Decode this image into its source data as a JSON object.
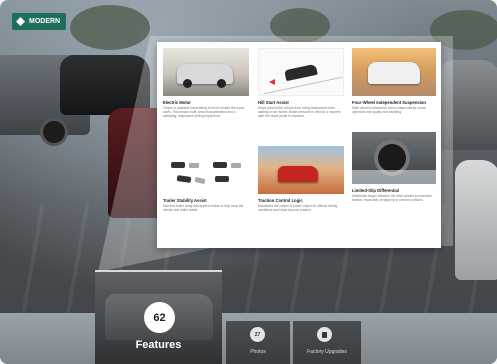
{
  "brand": {
    "name": "MODERN"
  },
  "feature_cards": [
    {
      "title": "Electric Motor",
      "description": "Torque is available immediately from the instant the motor starts. This means swift, smooth acceleration and a satisfying, responsive driving experience."
    },
    {
      "title": "Hill Start Assist",
      "description": "Helps prevent the vehicle from rolling backwards when starting on an incline. Brake pressure is held for a moment after the brake pedal is released."
    },
    {
      "title": "Four-Wheel Independent Suspension",
      "description": "Each wheel is allowed to move independently, which optimizes ride quality and handling."
    },
    {
      "title": "Trailer Stability Assist",
      "description": "Monitors trailer sway and applies brakes to help keep the vehicle and trailer stable."
    },
    {
      "title": "Traction Control Logic",
      "description": "Maximizes the control of power output for difficult driving conditions and helps improve traction."
    },
    {
      "title": "Limited-Slip Differential",
      "description": "Distributes torque between the drive wheels to maximize traction, especially on slippery or uneven surfaces."
    }
  ],
  "tabs": {
    "features": {
      "count": "62",
      "label": "Features"
    },
    "photos": {
      "count": "27",
      "label": "Photos"
    },
    "factory_upgrades": {
      "label": "Factory Upgrades"
    }
  },
  "colors": {
    "brand": "#1d6f5b",
    "bar": "#8c9499"
  }
}
